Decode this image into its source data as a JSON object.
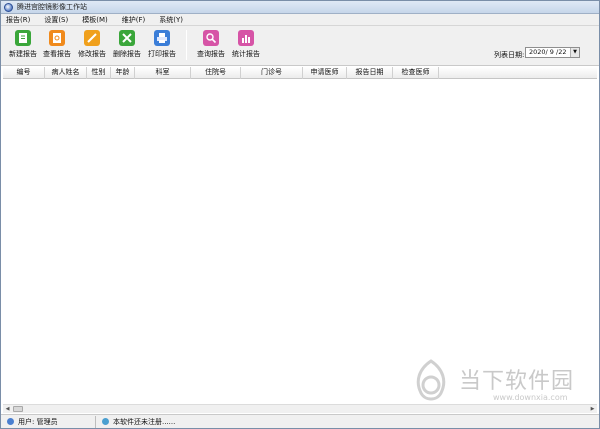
{
  "window": {
    "title": "腾进宫腔镜影像工作站"
  },
  "menu": [
    {
      "label": "报告(R)"
    },
    {
      "label": "设置(S)"
    },
    {
      "label": "模板(M)"
    },
    {
      "label": "维护(F)"
    },
    {
      "label": "系统(Y)"
    }
  ],
  "toolbar": {
    "buttons": [
      {
        "label": "新建报告",
        "icon": "new-report-icon",
        "color": "#3aa63a"
      },
      {
        "label": "查看报告",
        "icon": "view-report-icon",
        "color": "#f08a1c"
      },
      {
        "label": "修改报告",
        "icon": "edit-report-icon",
        "color": "#f0a01c"
      },
      {
        "label": "删除报告",
        "icon": "delete-report-icon",
        "color": "#3aa63a"
      },
      {
        "label": "打印报告",
        "icon": "print-report-icon",
        "color": "#3b7ed8"
      },
      {
        "label": "查询报告",
        "icon": "search-report-icon",
        "color": "#d654a6"
      },
      {
        "label": "统计报告",
        "icon": "stats-report-icon",
        "color": "#d654a6"
      }
    ]
  },
  "date_filter": {
    "label": "列表日期:",
    "value": "2020/ 9 /22"
  },
  "table": {
    "columns": [
      "编号",
      "病人姓名",
      "性别",
      "年龄",
      "科室",
      "住院号",
      "门诊号",
      "申请医师",
      "报告日期",
      "检查医师"
    ]
  },
  "status": {
    "user": "用户: 管理员",
    "registration": "本软件还未注册......"
  },
  "watermark": {
    "text": "当下软件园",
    "url": "www.downxia.com"
  }
}
